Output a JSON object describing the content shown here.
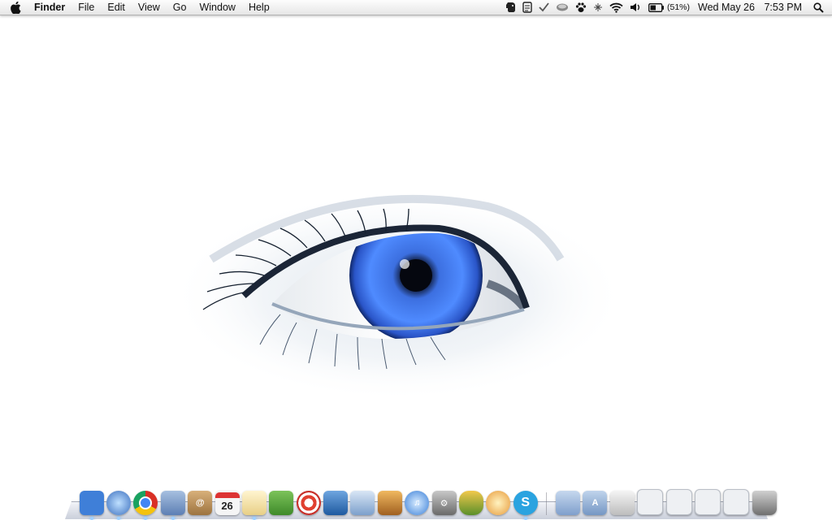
{
  "menubar": {
    "app_name": "Finder",
    "menus": [
      "File",
      "Edit",
      "View",
      "Go",
      "Window",
      "Help"
    ],
    "battery_percent": "(51%)",
    "clock_date": "Wed May 26",
    "clock_time": "7:53 PM"
  },
  "status_icons": [
    "evernote-icon",
    "notes-icon",
    "checkmark-icon",
    "bowl-icon",
    "paw-icon",
    "bluetooth-icon",
    "wifi-icon",
    "volume-icon",
    "battery-icon",
    "spotlight-icon"
  ],
  "dock": {
    "calendar_day": "26",
    "apps": [
      {
        "name": "finder",
        "color": "#3f7fd8",
        "running": true
      },
      {
        "name": "safari",
        "color": "#5a8fd0",
        "running": true
      },
      {
        "name": "chrome",
        "color": "#e8e8e8",
        "running": true
      },
      {
        "name": "preview",
        "color": "#6b87b8",
        "running": true
      },
      {
        "name": "address-book",
        "color": "#b78b55",
        "running": false
      },
      {
        "name": "ical",
        "color": "#f2f2f2",
        "running": false
      },
      {
        "name": "textedit",
        "color": "#f4e3a8",
        "running": true
      },
      {
        "name": "evernote",
        "color": "#5aa63b",
        "running": false
      },
      {
        "name": "screen-sharing",
        "color": "#d83a2e",
        "running": false
      },
      {
        "name": "mail",
        "color": "#2f6fb2",
        "running": false
      },
      {
        "name": "iphoto-library",
        "color": "#7ca0cc",
        "running": false
      },
      {
        "name": "iphoto",
        "color": "#c08a40",
        "running": false
      },
      {
        "name": "itunes",
        "color": "#4b8fe0",
        "running": false
      },
      {
        "name": "system-preferences",
        "color": "#8a8a8a",
        "running": false
      },
      {
        "name": "adium",
        "color": "#a07a2a",
        "running": false
      },
      {
        "name": "coda",
        "color": "#e89a3a",
        "running": false
      },
      {
        "name": "skype",
        "color": "#2aa3e0",
        "running": true
      }
    ],
    "stacks": [
      {
        "name": "documents-folder",
        "color": "#9ab7d8"
      },
      {
        "name": "applications-folder",
        "color": "#8fb0d6"
      },
      {
        "name": "printer",
        "color": "#dcdcdc"
      },
      {
        "name": "window-1",
        "color": "#e9ecf0"
      },
      {
        "name": "window-2",
        "color": "#e9ecf0"
      },
      {
        "name": "window-3",
        "color": "#e9ecf0"
      },
      {
        "name": "window-4",
        "color": "#e9ecf0"
      },
      {
        "name": "trash",
        "color": "#9a9a9a"
      }
    ]
  }
}
